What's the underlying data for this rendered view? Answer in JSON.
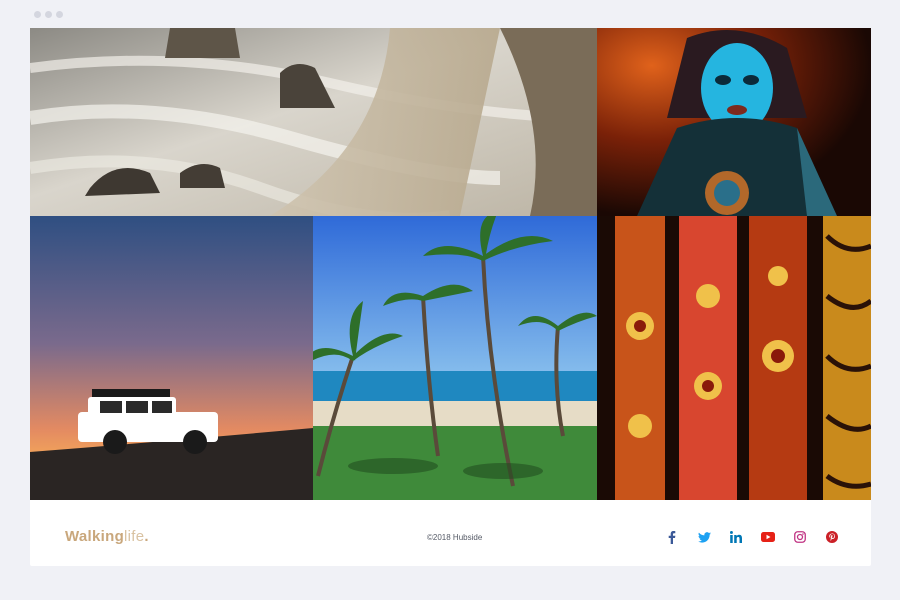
{
  "window": {
    "controls": [
      "dot",
      "dot",
      "dot"
    ]
  },
  "gallery": {
    "tiles": [
      {
        "id": "coast",
        "subject": "rocky coastline with sea stacks"
      },
      {
        "id": "mask",
        "subject": "performer with blue painted face and headdress"
      },
      {
        "id": "sunset",
        "subject": "off-road vehicle silhouetted at sunset"
      },
      {
        "id": "palms",
        "subject": "palm trees on a tropical beach"
      },
      {
        "id": "art",
        "subject": "painted didgeridoos with dot art"
      }
    ]
  },
  "footer": {
    "logo_bold": "Walking",
    "logo_light": "life",
    "logo_dot": ".",
    "copyright": "©2018 Hubside",
    "social": [
      {
        "icon": "facebook-icon",
        "color": "#3b5998"
      },
      {
        "icon": "twitter-icon",
        "color": "#1da1f2"
      },
      {
        "icon": "linkedin-icon",
        "color": "#0077b5"
      },
      {
        "icon": "youtube-icon",
        "color": "#e62117"
      },
      {
        "icon": "instagram-icon",
        "color": "#c13584"
      },
      {
        "icon": "pinterest-icon",
        "color": "#cb2027"
      }
    ]
  },
  "colors": {
    "background": "#f0f1f6",
    "logo_gold": "#c9a77c",
    "logo_light": "#d9c2a2"
  }
}
